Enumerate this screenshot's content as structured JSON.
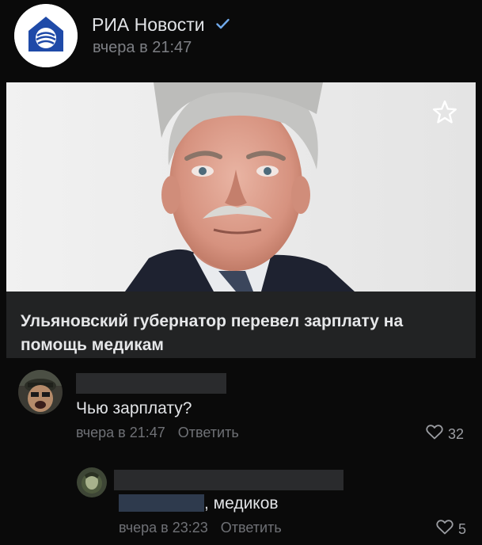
{
  "post": {
    "publisher_name": "РИА Новости",
    "publisher_verified": true,
    "time": "вчера в 21:47",
    "icons": {
      "logo": "ria-logo-icon",
      "verified": "checkmark-icon",
      "bookmark": "star-icon"
    }
  },
  "article": {
    "title": "Ульяновский губернатор перевел зарплату на помощь медикам"
  },
  "comments": [
    {
      "author": "",
      "text": "Чью зарплату?",
      "time": "вчера в 21:47",
      "reply_label": "Ответить",
      "likes": "32"
    },
    {
      "author": "",
      "mention": "",
      "text": ", медиков",
      "time": "вчера в 23:23",
      "reply_label": "Ответить",
      "likes": "5"
    }
  ],
  "colors": {
    "background": "#0a0a0a",
    "card": "#222324",
    "brand": "#1f4aa8",
    "verified": "#71aaeb",
    "muted_text": "#7d7f84"
  }
}
